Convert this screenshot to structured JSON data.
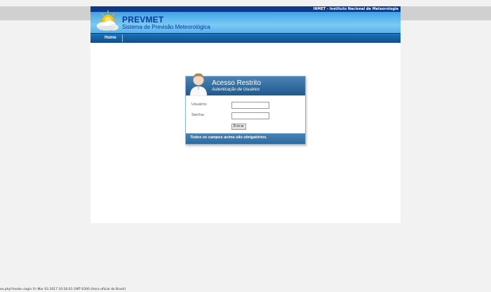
{
  "header": {
    "institution": "INMET - Instituto Nacional de Meteorologia",
    "brand": "PREVMET",
    "tagline": "Sistema de Previsão Meteorológica",
    "logo_icon": "sun-cloud-icon"
  },
  "nav": {
    "home_label": "Home"
  },
  "login": {
    "title": "Acesso Restrito",
    "subtitle": "Autenticação de Usuários",
    "username_label": "Usuário:",
    "username_value": "",
    "password_label": "Senha:",
    "password_value": "",
    "submit_label": "Entrar",
    "footer_note": "Todos os campos acima são obrigatórios.",
    "avatar_icon": "user-avatar-icon"
  },
  "status_bar": {
    "text": "ex.php?mode=login Fri Mar 03 2017 10:26:01 GMT-0300 (Hora oficial do Brasil)"
  },
  "colors": {
    "navy": "#0b3a8a",
    "banner_blue": "#4fb0ec",
    "panel_blue": "#2f6ea3",
    "background": "#f2f2f2"
  }
}
